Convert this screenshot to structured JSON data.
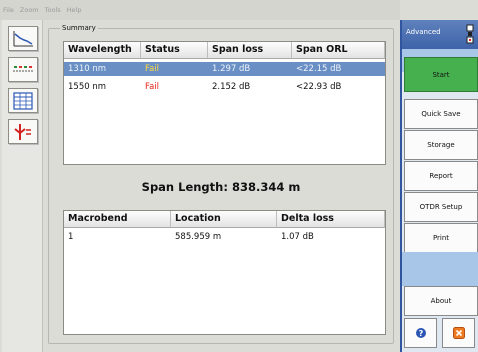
{
  "menu": [
    "File",
    "Zoom",
    "Tools",
    "Help"
  ],
  "summary": {
    "legend": "Summary",
    "results": {
      "headers": [
        "Wavelength",
        "Status",
        "Span loss",
        "Span ORL"
      ],
      "rows": [
        {
          "wavelength": "1310 nm",
          "status": "Fail",
          "span_loss": "1.297 dB",
          "span_orl": "<22.15 dB",
          "selected": true
        },
        {
          "wavelength": "1550 nm",
          "status": "Fail",
          "span_loss": "2.152 dB",
          "span_orl": "<22.93 dB",
          "selected": false
        }
      ]
    },
    "span_length": "Span Length: 838.344 m",
    "events": {
      "headers": [
        "Macrobend",
        "Location",
        "Delta loss"
      ],
      "rows": [
        {
          "macrobend": "1",
          "location": "585.959 m",
          "delta_loss": "1.07 dB"
        }
      ]
    }
  },
  "left_toolbar": {
    "icons": [
      "trace-graph-icon",
      "event-linear-view-icon",
      "table-grid-icon",
      "event-markers-icon"
    ]
  },
  "right_panel": {
    "title": "Advanced",
    "buttons": {
      "start": "Start",
      "quick_save": "Quick Save",
      "storage": "Storage",
      "report": "Report",
      "otdr_setup": "OTDR Setup",
      "print": "Print",
      "about": "About"
    },
    "bottom_icons": [
      "help-icon",
      "exit-icon"
    ]
  },
  "colors": {
    "panel_accent": "#3e63a8",
    "start_button": "#46b04e",
    "selection": "#6a8fc4",
    "fail_text": "#e8231b",
    "fail_text_selected": "#ffd93f"
  }
}
